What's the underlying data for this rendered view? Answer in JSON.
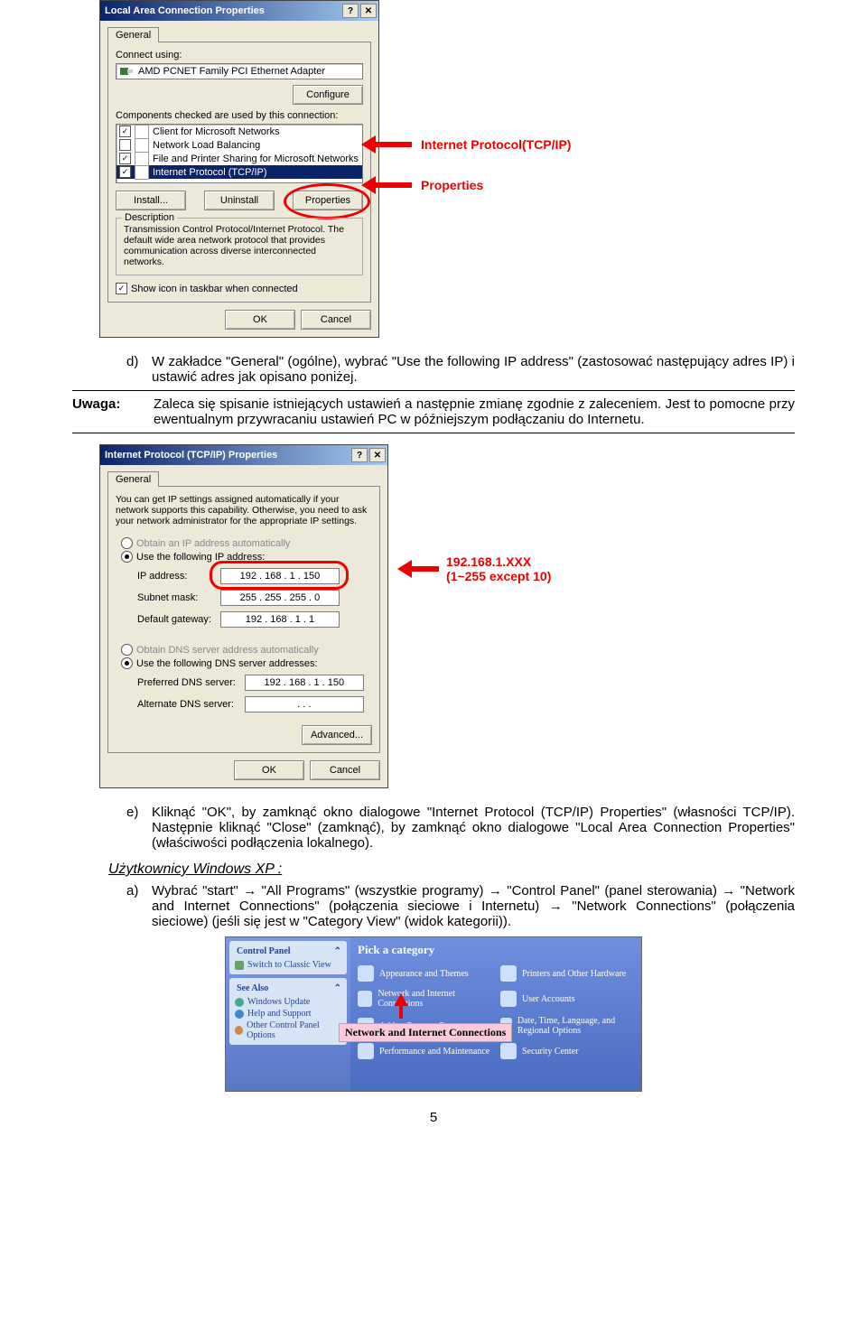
{
  "dialog1": {
    "title": "Local Area Connection Properties",
    "tab": "General",
    "connect_label": "Connect using:",
    "adapter": "AMD PCNET Family PCI Ethernet Adapter",
    "configure": "Configure",
    "components_label": "Components checked are used by this connection:",
    "items": [
      {
        "checked": true,
        "label": "Client for Microsoft Networks"
      },
      {
        "checked": false,
        "label": "Network Load Balancing"
      },
      {
        "checked": true,
        "label": "File and Printer Sharing for Microsoft Networks"
      },
      {
        "checked": true,
        "label": "Internet Protocol (TCP/IP)",
        "selected": true
      }
    ],
    "install": "Install...",
    "uninstall": "Uninstall",
    "properties": "Properties",
    "desc_label": "Description",
    "desc_text": "Transmission Control Protocol/Internet Protocol. The default wide area network protocol that provides communication across diverse interconnected networks.",
    "show_icon": "Show icon in taskbar when connected",
    "ok": "OK",
    "cancel": "Cancel"
  },
  "callout1": {
    "label1": "Internet Protocol(TCP/IP)",
    "label2": "Properties"
  },
  "text": {
    "d_letter": "d)",
    "d_body": "W zakładce \"General\" (ogólne), wybrać \"Use the following IP address\" (zastosować następujący adres IP) i ustawić adres jak opisano poniżej.",
    "uwaga_label": "Uwaga:",
    "uwaga_body": "Zaleca się spisanie istniejących ustawień a następnie zmianę zgodnie z zaleceniem. Jest to pomocne przy ewentualnym przywracaniu ustawień PC w późniejszym podłączaniu do Internetu.",
    "e_letter": "e)",
    "e_body": "Kliknąć \"OK\", by zamknąć okno dialogowe \"Internet Protocol (TCP/IP) Properties\" (własności TCP/IP). Następnie kliknąć \"Close\" (zamknąć), by zamknąć okno dialogowe \"Local Area Connection Properties\" (właściwości podłączenia lokalnego).",
    "subhead": "Użytkownicy Windows XP :",
    "a_letter": "a)",
    "a_body": "Wybrać \"start\" → \"All Programs\" (wszystkie programy) → \"Control Panel\" (panel sterowania) → \"Network and Internet Connections\" (połączenia sieciowe i Internetu) → \"Network Connections\" (połączenia sieciowe) (jeśli się jest w \"Category View\" (widok kategorii)).",
    "pagenum": "5"
  },
  "dialog2": {
    "title": "Internet Protocol (TCP/IP) Properties",
    "tab": "General",
    "intro": "You can get IP settings assigned automatically if your network supports this capability. Otherwise, you need to ask your network administrator for the appropriate IP settings.",
    "radio_auto_ip": "Obtain an IP address automatically",
    "radio_use_ip": "Use the following IP address:",
    "ip_label": "IP address:",
    "ip_value": "192 . 168 .   1 . 150",
    "subnet_label": "Subnet mask:",
    "subnet_value": "255 . 255 . 255 .   0",
    "gw_label": "Default gateway:",
    "gw_value": "192 . 168 .   1 .   1",
    "radio_auto_dns": "Obtain DNS server address automatically",
    "radio_use_dns": "Use the following DNS server addresses:",
    "pref_dns_label": "Preferred DNS server:",
    "pref_dns_value": "192 . 168 .   1 . 150",
    "alt_dns_label": "Alternate DNS server:",
    "alt_dns_value": "   .      .      .   ",
    "advanced": "Advanced...",
    "ok": "OK",
    "cancel": "Cancel"
  },
  "callout2": {
    "line1": "192.168.1.XXX",
    "line2": "(1~255 except 10)"
  },
  "xp": {
    "panel1_title": "Control Panel",
    "panel1_link": "Switch to Classic View",
    "panel2_title": "See Also",
    "panel2_links": [
      "Windows Update",
      "Help and Support",
      "Other Control Panel Options"
    ],
    "main_title": "Pick a category",
    "cats": [
      "Appearance and Themes",
      "Printers and Other Hardware",
      "Network and Internet Connections",
      "User Accounts",
      "Add or Remove Programs",
      "Date, Time, Language, and Regional Options",
      "Performance and Maintenance",
      "Security Center"
    ],
    "pink_label": "Network and Internet Connections"
  }
}
